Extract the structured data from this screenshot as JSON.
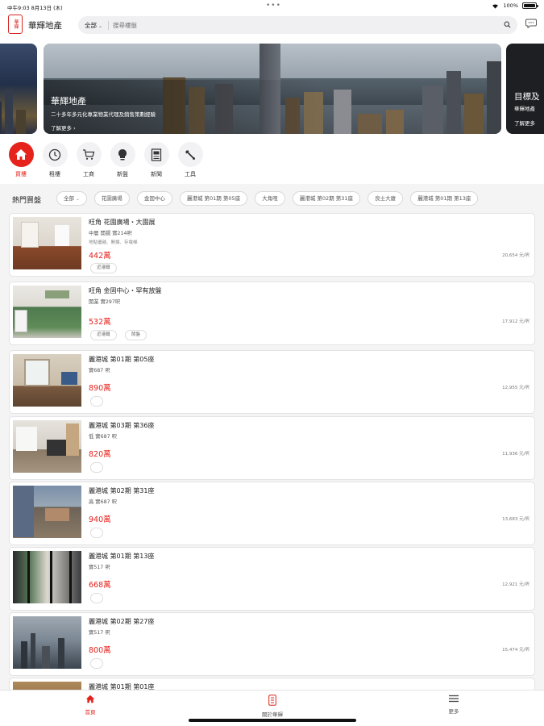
{
  "status_bar": {
    "time_date": "中午9:03  8月13日 (木)",
    "dots": "•••",
    "battery": "100%"
  },
  "header": {
    "logo_text": "華輝",
    "brand": "華輝地產",
    "search_scope": "全部",
    "search_placeholder": "搜尋樓盤"
  },
  "banner": {
    "title": "華輝地產",
    "subtitle": "二十多年多元化專業物業代理及銷售策劃經驗",
    "more_label": "了解更多 ›",
    "next_title": "目標及",
    "next_subtitle": "華輝地產",
    "next_more": "了解更多"
  },
  "quick_nav": [
    {
      "label": "買樓",
      "icon": "home-icon",
      "active": true
    },
    {
      "label": "租樓",
      "icon": "clock-icon",
      "active": false
    },
    {
      "label": "工商",
      "icon": "cart-icon",
      "active": false
    },
    {
      "label": "新盤",
      "icon": "bulb-icon",
      "active": false
    },
    {
      "label": "新聞",
      "icon": "news-icon",
      "active": false
    },
    {
      "label": "工具",
      "icon": "tools-icon",
      "active": false
    }
  ],
  "hot": {
    "title": "熱門買盤",
    "filter_all": "全部",
    "chips": [
      "花園廣場",
      "金固中心",
      "麗港城 第01期 第05座",
      "大角咀",
      "麗港城 第02期 第31座",
      "良士大廈",
      "麗港城 第01期 第13座"
    ]
  },
  "listings": [
    {
      "title": "旺角 花園廣場・大園展",
      "sub": "中層 開揚 實214呎",
      "features": "地點優越、開揚、存電梯",
      "price": "442萬",
      "unit_price": "20,654 元/呎",
      "tags": [
        "近港鐵"
      ]
    },
    {
      "title": "旺角 金固中心・罕有放盤",
      "sub": "開業 實297呎",
      "features": "",
      "price": "532萬",
      "unit_price": "17,912 元/呎",
      "tags": [
        "近港鐵",
        "鬧盤"
      ]
    },
    {
      "title": "麗港城 第01期 第05座",
      "sub": "實687 呎",
      "features": "",
      "price": "890萬",
      "unit_price": "12,955 元/呎",
      "tags": []
    },
    {
      "title": "麗港城 第03期 第36座",
      "sub": "低 實687 呎",
      "features": "",
      "price": "820萬",
      "unit_price": "11,936 元/呎",
      "tags": []
    },
    {
      "title": "麗港城 第02期 第31座",
      "sub": "高 實687 呎",
      "features": "",
      "price": "940萬",
      "unit_price": "13,683 元/呎",
      "tags": []
    },
    {
      "title": "麗港城 第01期 第13座",
      "sub": "實517 呎",
      "features": "",
      "price": "668萬",
      "unit_price": "12,921 元/呎",
      "tags": []
    },
    {
      "title": "麗港城 第02期 第27座",
      "sub": "實517 呎",
      "features": "",
      "price": "800萬",
      "unit_price": "15,474 元/呎",
      "tags": []
    },
    {
      "title": "麗港城 第01期 第01座",
      "sub": "",
      "features": "",
      "price": "",
      "unit_price": "",
      "tags": []
    }
  ],
  "tab_bar": [
    {
      "label": "首頁",
      "icon": "home-icon",
      "active": true
    },
    {
      "label": "關於華輝",
      "icon": "brand-logo-icon",
      "active": false
    },
    {
      "label": "更多",
      "icon": "menu-icon",
      "active": false
    }
  ],
  "colors": {
    "accent": "#e5221c",
    "background": "#f4f4f5",
    "card_border": "#e3e3e6"
  }
}
